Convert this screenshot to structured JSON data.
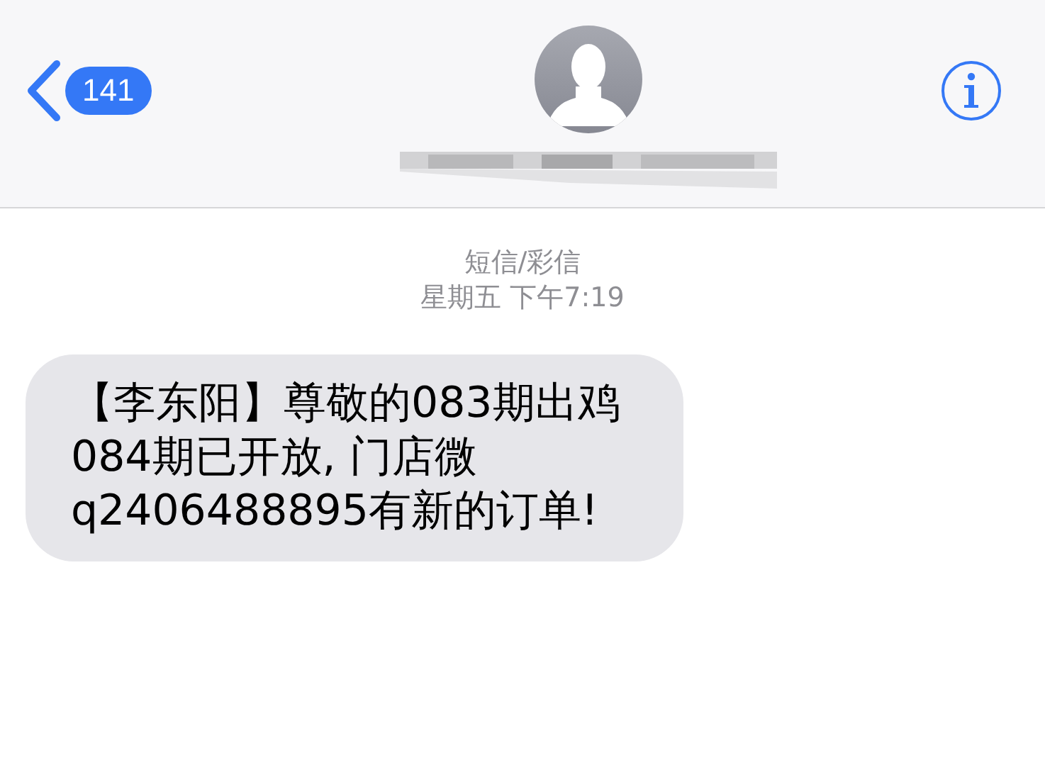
{
  "header": {
    "back_count": "141"
  },
  "thread": {
    "service": "短信/彩信",
    "timestamp": "星期五 下午7:19"
  },
  "messages": [
    {
      "kind": "received",
      "text": "【李东阳】尊敬的083期出鸡084期已开放, 门店微q2406488895有新的订单!"
    }
  ]
}
